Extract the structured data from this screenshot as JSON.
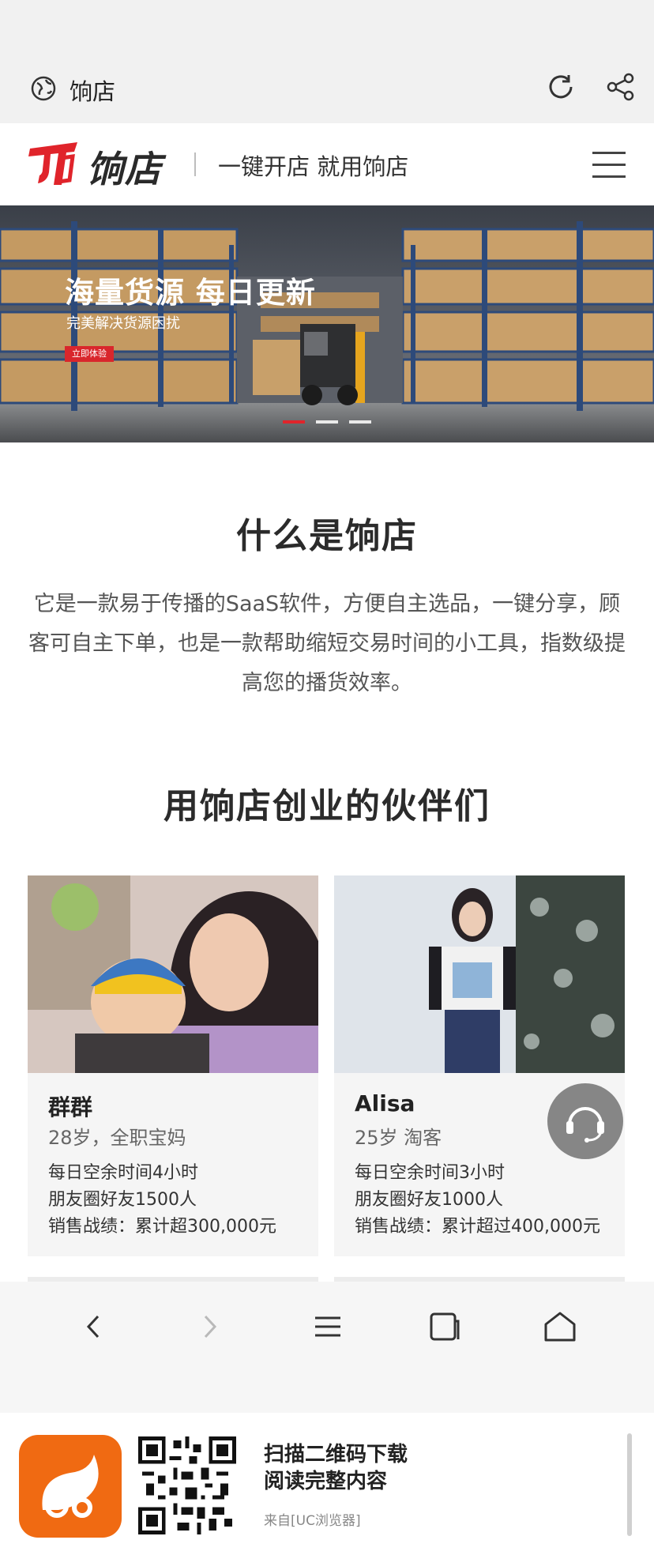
{
  "browser": {
    "page_title": "饷店",
    "icons": {
      "globe": "globe-icon",
      "reload": "reload-icon",
      "share": "share-icon"
    }
  },
  "header": {
    "logo_text": "饷店",
    "slogan": "一键开店 就用饷店",
    "menu_icon": "hamburger-menu-icon",
    "brand_color": "#e0242b"
  },
  "banner": {
    "headline": "海量货源 每日更新",
    "subline": "完美解决货源困扰",
    "cta": "立即体验",
    "slide_count": 3,
    "active_slide": 1
  },
  "about": {
    "title": "什么是饷店",
    "text": "它是一款易于传播的SaaS软件，方便自主选品，一键分享，顾客可自主下单，也是一款帮助缩短交易时间的小工具，指数级提高您的播货效率。"
  },
  "partners": {
    "title": "用饷店创业的伙伴们",
    "cards": [
      {
        "name": "群群",
        "meta": "28岁，全职宝妈",
        "lines": [
          "每日空余时间4小时",
          "朋友圈好友1500人",
          "销售战绩：累计超300,000元"
        ]
      },
      {
        "name": "Alisa",
        "meta": "25岁 淘客",
        "lines": [
          "每日空余时间3小时",
          "朋友圈好友1000人",
          "销售战绩：累计超过400,000元"
        ]
      }
    ]
  },
  "support_button_icon": "customer-service-icon",
  "bottom_nav": {
    "icons": [
      "back-icon",
      "forward-icon",
      "menu-icon",
      "tabs-icon",
      "home-icon"
    ]
  },
  "uc_banner": {
    "line1": "扫描二维码下载",
    "line2": "阅读完整内容",
    "source": "来自[UC浏览器]"
  }
}
